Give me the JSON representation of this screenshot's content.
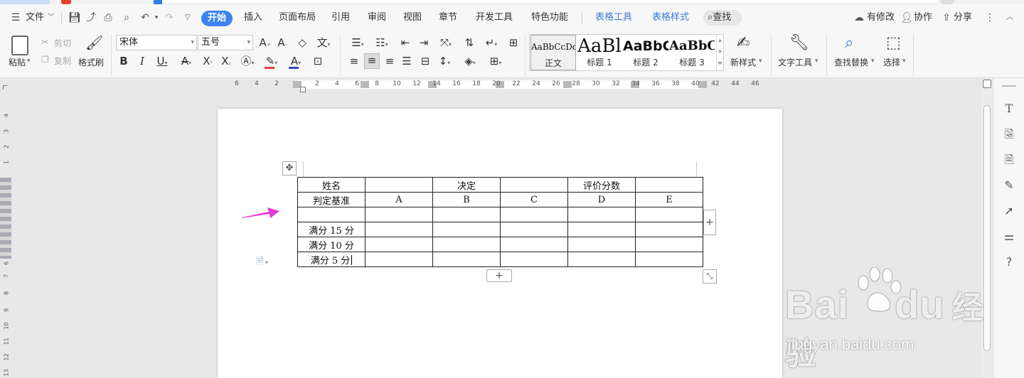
{
  "app": {
    "file_menu": "文件",
    "tabs": [
      "开始",
      "插入",
      "页面布局",
      "引用",
      "审阅",
      "视图",
      "章节",
      "开发工具",
      "特色功能"
    ],
    "context_tabs": [
      "表格工具",
      "表格样式"
    ],
    "search": "查找",
    "right_actions": {
      "modified": "有修改",
      "collab": "协作",
      "share": "分享"
    }
  },
  "ribbon": {
    "paste": "粘贴",
    "cut": "剪切",
    "copy": "复制",
    "format_painter": "格式刷",
    "font_name": "宋体",
    "font_size": "五号",
    "styles": [
      {
        "sample": "AaBbCcDd",
        "name": "正文"
      },
      {
        "sample": "AaBl",
        "name": "标题 1"
      },
      {
        "sample": "AaBbC",
        "name": "标题 2"
      },
      {
        "sample": "AaBbC",
        "name": "标题 3"
      }
    ],
    "new_style": "新样式",
    "text_tools": "文字工具",
    "find_replace": "查找替换",
    "select": "选择"
  },
  "ruler": {
    "h_left": [
      "6",
      "4",
      "2"
    ],
    "h_right": [
      "2",
      "4",
      "6",
      "8",
      "10",
      "12",
      "14",
      "16",
      "18",
      "20",
      "22",
      "24",
      "26",
      "28",
      "30",
      "32",
      "34",
      "36",
      "38",
      "40",
      "42",
      "44",
      "46"
    ],
    "v": [
      "4",
      "3",
      "2",
      "1",
      "1",
      "2",
      "3",
      "4",
      "5",
      "6",
      "7",
      "8",
      "9",
      "10",
      "11",
      "12",
      "13"
    ]
  },
  "table": {
    "rows": [
      [
        "姓名",
        "",
        "决定",
        "",
        "评价分数",
        ""
      ],
      [
        "判定基准",
        "A",
        "B",
        "C",
        "D",
        "E"
      ],
      [
        "",
        "",
        "",
        "",
        "",
        ""
      ],
      [
        "满分 15 分",
        "",
        "",
        "",
        "",
        ""
      ],
      [
        "满分 10 分",
        "",
        "",
        "",
        "",
        ""
      ],
      [
        "满分 5 分",
        "",
        "",
        "",
        "",
        ""
      ]
    ]
  },
  "watermark": {
    "big": "Bai",
    "big2": "du",
    "cn": "经验",
    "url": "jingyan.baidu.com"
  },
  "colors": {
    "accent": "#3d84f0",
    "arrow": "#e83ad7",
    "font_color_bar": "#e63b3b",
    "font_color_bar2": "#2d4cc8"
  }
}
